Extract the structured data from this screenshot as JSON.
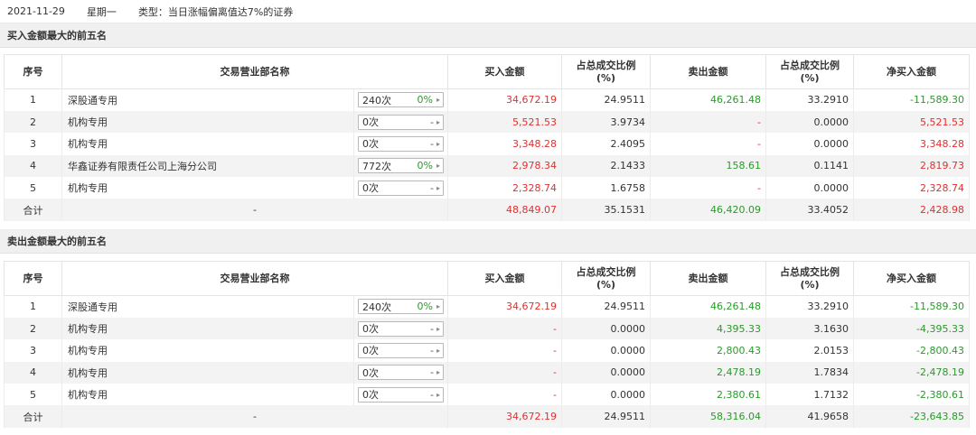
{
  "topbar": {
    "date": "2021-11-29",
    "weekday": "星期一",
    "type": "类型：当日涨幅偏离值达7%的证券"
  },
  "headers": {
    "idx": "序号",
    "name": "交易营业部名称",
    "buy": "买入金额",
    "buy_ratio_line1": "占总成交比例",
    "buy_ratio_line2": "(%)",
    "sell": "卖出金额",
    "sell_ratio_line1": "占总成交比例",
    "sell_ratio_line2": "(%)",
    "net": "净买入金额"
  },
  "section1": {
    "title": "买入金额最大的前五名",
    "rows": [
      {
        "idx": "1",
        "name": "深股通专用",
        "count": "240次",
        "pct": "0%",
        "dash": "",
        "buy": "34,672.19",
        "buy_ratio": "24.9511",
        "sell": "46,261.48",
        "sell_ratio": "33.2910",
        "net": "-11,589.30"
      },
      {
        "idx": "2",
        "name": "机构专用",
        "count": "0次",
        "pct": "",
        "dash": "-",
        "buy": "5,521.53",
        "buy_ratio": "3.9734",
        "sell": "-",
        "sell_ratio": "0.0000",
        "net": "5,521.53"
      },
      {
        "idx": "3",
        "name": "机构专用",
        "count": "0次",
        "pct": "",
        "dash": "-",
        "buy": "3,348.28",
        "buy_ratio": "2.4095",
        "sell": "-",
        "sell_ratio": "0.0000",
        "net": "3,348.28"
      },
      {
        "idx": "4",
        "name": "华鑫证券有限责任公司上海分公司",
        "count": "772次",
        "pct": "0%",
        "dash": "",
        "buy": "2,978.34",
        "buy_ratio": "2.1433",
        "sell": "158.61",
        "sell_ratio": "0.1141",
        "net": "2,819.73"
      },
      {
        "idx": "5",
        "name": "机构专用",
        "count": "0次",
        "pct": "",
        "dash": "-",
        "buy": "2,328.74",
        "buy_ratio": "1.6758",
        "sell": "-",
        "sell_ratio": "0.0000",
        "net": "2,328.74"
      }
    ],
    "total": {
      "label": "合计",
      "name": "-",
      "buy": "48,849.07",
      "buy_ratio": "35.1531",
      "sell": "46,420.09",
      "sell_ratio": "33.4052",
      "net": "2,428.98"
    }
  },
  "section2": {
    "title": "卖出金额最大的前五名",
    "rows": [
      {
        "idx": "1",
        "name": "深股通专用",
        "count": "240次",
        "pct": "0%",
        "dash": "",
        "buy": "34,672.19",
        "buy_ratio": "24.9511",
        "sell": "46,261.48",
        "sell_ratio": "33.2910",
        "net": "-11,589.30"
      },
      {
        "idx": "2",
        "name": "机构专用",
        "count": "0次",
        "pct": "",
        "dash": "-",
        "buy": "-",
        "buy_ratio": "0.0000",
        "sell": "4,395.33",
        "sell_ratio": "3.1630",
        "net": "-4,395.33"
      },
      {
        "idx": "3",
        "name": "机构专用",
        "count": "0次",
        "pct": "",
        "dash": "-",
        "buy": "-",
        "buy_ratio": "0.0000",
        "sell": "2,800.43",
        "sell_ratio": "2.0153",
        "net": "-2,800.43"
      },
      {
        "idx": "4",
        "name": "机构专用",
        "count": "0次",
        "pct": "",
        "dash": "-",
        "buy": "-",
        "buy_ratio": "0.0000",
        "sell": "2,478.19",
        "sell_ratio": "1.7834",
        "net": "-2,478.19"
      },
      {
        "idx": "5",
        "name": "机构专用",
        "count": "0次",
        "pct": "",
        "dash": "-",
        "buy": "-",
        "buy_ratio": "0.0000",
        "sell": "2,380.61",
        "sell_ratio": "1.7132",
        "net": "-2,380.61"
      }
    ],
    "total": {
      "label": "合计",
      "name": "-",
      "buy": "34,672.19",
      "buy_ratio": "24.9511",
      "sell": "58,316.04",
      "sell_ratio": "41.9658",
      "net": "-23,643.85"
    }
  },
  "colors": {
    "up": "#e03030",
    "down": "#2a9a2a",
    "header_bg": "#f0f0f0"
  }
}
